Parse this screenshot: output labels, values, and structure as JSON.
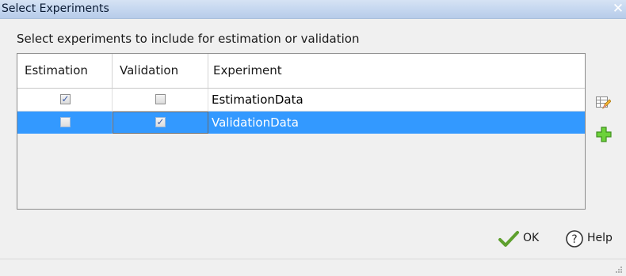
{
  "window": {
    "title": "Select Experiments",
    "close_icon": "close-icon",
    "close_glyph": "✕"
  },
  "instruction": "Select experiments to include for estimation or validation",
  "table": {
    "columns": [
      "Estimation",
      "Validation",
      "Experiment"
    ],
    "rows": [
      {
        "estimation": true,
        "validation": false,
        "experiment": "EstimationData",
        "selected": false
      },
      {
        "estimation": false,
        "validation": true,
        "experiment": "ValidationData",
        "selected": true
      }
    ]
  },
  "side_actions": {
    "edit_icon": "edit-table-icon",
    "add_icon": "add-icon"
  },
  "buttons": {
    "ok_label": "OK",
    "help_label": "Help",
    "ok_icon": "checkmark-icon",
    "help_icon": "help-icon"
  },
  "colors": {
    "selection": "#3399ff",
    "add_green": "#4cbb17",
    "check_green": "#5ea02e",
    "accent_blue": "#3a5ba8"
  }
}
